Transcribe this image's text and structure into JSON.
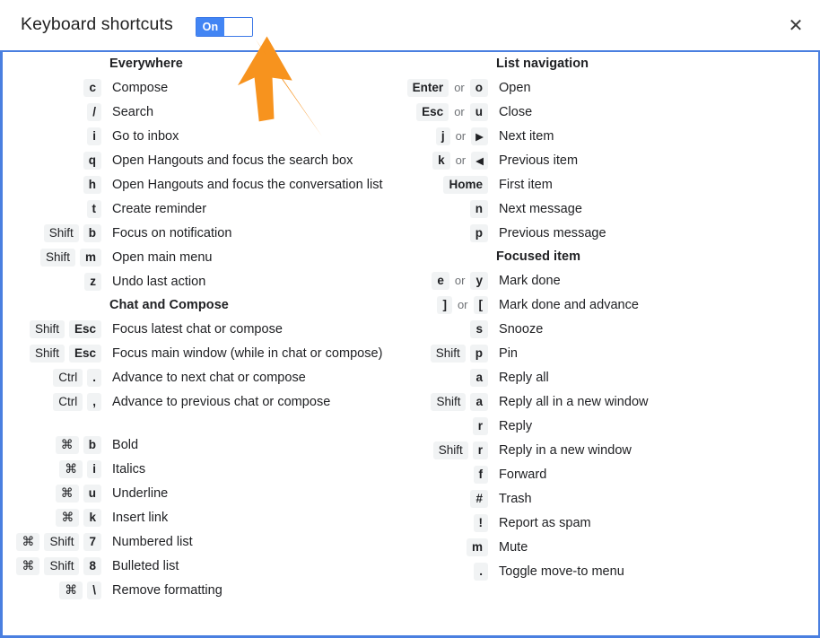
{
  "header": {
    "title": "Keyboard shortcuts",
    "toggle": {
      "state_label": "On",
      "enabled": true,
      "accent_color": "#4285f4"
    },
    "close_label": "✕"
  },
  "annotation": {
    "type": "arrow-cursor",
    "color": "#f7931e",
    "points_to": "keyboard-shortcuts-toggle"
  },
  "columns": {
    "left": [
      {
        "heading": "Everywhere",
        "rows": [
          {
            "keys": [
              {
                "text": "c",
                "style": "letter"
              }
            ],
            "desc": "Compose"
          },
          {
            "keys": [
              {
                "text": "/",
                "style": "letter"
              }
            ],
            "desc": "Search"
          },
          {
            "keys": [
              {
                "text": "i",
                "style": "letter"
              }
            ],
            "desc": "Go to inbox"
          },
          {
            "keys": [
              {
                "text": "q",
                "style": "letter"
              }
            ],
            "desc": "Open Hangouts and focus the search box"
          },
          {
            "keys": [
              {
                "text": "h",
                "style": "letter"
              }
            ],
            "desc": "Open Hangouts and focus the conversation list"
          },
          {
            "keys": [
              {
                "text": "t",
                "style": "letter"
              }
            ],
            "desc": "Create reminder"
          },
          {
            "keys": [
              {
                "text": "Shift",
                "style": "word"
              },
              {
                "text": "b",
                "style": "letter"
              }
            ],
            "desc": "Focus on notification"
          },
          {
            "keys": [
              {
                "text": "Shift",
                "style": "word"
              },
              {
                "text": "m",
                "style": "letter"
              }
            ],
            "desc": "Open main menu"
          },
          {
            "keys": [
              {
                "text": "z",
                "style": "letter"
              }
            ],
            "desc": "Undo last action"
          }
        ]
      },
      {
        "heading": "Chat and Compose",
        "rows": [
          {
            "keys": [
              {
                "text": "Shift",
                "style": "word"
              },
              {
                "text": "Esc",
                "style": "letter"
              }
            ],
            "desc": "Focus latest chat or compose"
          },
          {
            "keys": [
              {
                "text": "Shift",
                "style": "word"
              },
              {
                "text": "Esc",
                "style": "letter"
              }
            ],
            "desc": "Focus main window (while in chat or compose)"
          },
          {
            "keys": [
              {
                "text": "Ctrl",
                "style": "word"
              },
              {
                "text": ".",
                "style": "letter"
              }
            ],
            "desc": "Advance to next chat or compose"
          },
          {
            "keys": [
              {
                "text": "Ctrl",
                "style": "word"
              },
              {
                "text": ",",
                "style": "letter"
              }
            ],
            "desc": "Advance to previous chat or compose"
          },
          {
            "spacer": true
          },
          {
            "keys": [
              {
                "text": "⌘",
                "style": "glyph"
              },
              {
                "text": "b",
                "style": "letter"
              }
            ],
            "desc": "Bold"
          },
          {
            "keys": [
              {
                "text": "⌘",
                "style": "glyph"
              },
              {
                "text": "i",
                "style": "letter"
              }
            ],
            "desc": "Italics"
          },
          {
            "keys": [
              {
                "text": "⌘",
                "style": "glyph"
              },
              {
                "text": "u",
                "style": "letter"
              }
            ],
            "desc": "Underline"
          },
          {
            "keys": [
              {
                "text": "⌘",
                "style": "glyph"
              },
              {
                "text": "k",
                "style": "letter"
              }
            ],
            "desc": "Insert link"
          },
          {
            "keys": [
              {
                "text": "⌘",
                "style": "glyph"
              },
              {
                "text": "Shift",
                "style": "word"
              },
              {
                "text": "7",
                "style": "letter"
              }
            ],
            "desc": "Numbered list"
          },
          {
            "keys": [
              {
                "text": "⌘",
                "style": "glyph"
              },
              {
                "text": "Shift",
                "style": "word"
              },
              {
                "text": "8",
                "style": "letter"
              }
            ],
            "desc": "Bulleted list"
          },
          {
            "keys": [
              {
                "text": "⌘",
                "style": "glyph"
              },
              {
                "text": "\\",
                "style": "letter"
              }
            ],
            "desc": "Remove formatting"
          }
        ]
      }
    ],
    "right": [
      {
        "heading": "List navigation",
        "rows": [
          {
            "keys": [
              {
                "text": "Enter",
                "style": "letter"
              },
              {
                "text": "or",
                "style": "sep"
              },
              {
                "text": "o",
                "style": "letter"
              }
            ],
            "desc": "Open"
          },
          {
            "keys": [
              {
                "text": "Esc",
                "style": "letter"
              },
              {
                "text": "or",
                "style": "sep"
              },
              {
                "text": "u",
                "style": "letter"
              }
            ],
            "desc": "Close"
          },
          {
            "keys": [
              {
                "text": "j",
                "style": "letter"
              },
              {
                "text": "or",
                "style": "sep"
              },
              {
                "text": "▶",
                "style": "arrow"
              }
            ],
            "desc": "Next item"
          },
          {
            "keys": [
              {
                "text": "k",
                "style": "letter"
              },
              {
                "text": "or",
                "style": "sep"
              },
              {
                "text": "◀",
                "style": "arrow"
              }
            ],
            "desc": "Previous item"
          },
          {
            "keys": [
              {
                "text": "Home",
                "style": "letter"
              }
            ],
            "desc": "First item"
          },
          {
            "keys": [
              {
                "text": "n",
                "style": "letter"
              }
            ],
            "desc": "Next message"
          },
          {
            "keys": [
              {
                "text": "p",
                "style": "letter"
              }
            ],
            "desc": "Previous message"
          }
        ]
      },
      {
        "heading": "Focused item",
        "rows": [
          {
            "keys": [
              {
                "text": "e",
                "style": "letter"
              },
              {
                "text": "or",
                "style": "sep"
              },
              {
                "text": "y",
                "style": "letter"
              }
            ],
            "desc": "Mark done"
          },
          {
            "keys": [
              {
                "text": "]",
                "style": "letter"
              },
              {
                "text": "or",
                "style": "sep"
              },
              {
                "text": "[",
                "style": "letter"
              }
            ],
            "desc": "Mark done and advance"
          },
          {
            "keys": [
              {
                "text": "s",
                "style": "letter"
              }
            ],
            "desc": "Snooze"
          },
          {
            "keys": [
              {
                "text": "Shift",
                "style": "word"
              },
              {
                "text": "p",
                "style": "letter"
              }
            ],
            "desc": "Pin"
          },
          {
            "keys": [
              {
                "text": "a",
                "style": "letter"
              }
            ],
            "desc": "Reply all"
          },
          {
            "keys": [
              {
                "text": "Shift",
                "style": "word"
              },
              {
                "text": "a",
                "style": "letter"
              }
            ],
            "desc": "Reply all in a new window"
          },
          {
            "keys": [
              {
                "text": "r",
                "style": "letter"
              }
            ],
            "desc": "Reply"
          },
          {
            "keys": [
              {
                "text": "Shift",
                "style": "word"
              },
              {
                "text": "r",
                "style": "letter"
              }
            ],
            "desc": "Reply in a new window"
          },
          {
            "keys": [
              {
                "text": "f",
                "style": "letter"
              }
            ],
            "desc": "Forward"
          },
          {
            "keys": [
              {
                "text": "#",
                "style": "letter"
              }
            ],
            "desc": "Trash"
          },
          {
            "keys": [
              {
                "text": "!",
                "style": "letter"
              }
            ],
            "desc": "Report as spam"
          },
          {
            "keys": [
              {
                "text": "m",
                "style": "letter"
              }
            ],
            "desc": "Mute"
          },
          {
            "keys": [
              {
                "text": ".",
                "style": "letter"
              }
            ],
            "desc": "Toggle move-to menu"
          }
        ]
      }
    ]
  }
}
